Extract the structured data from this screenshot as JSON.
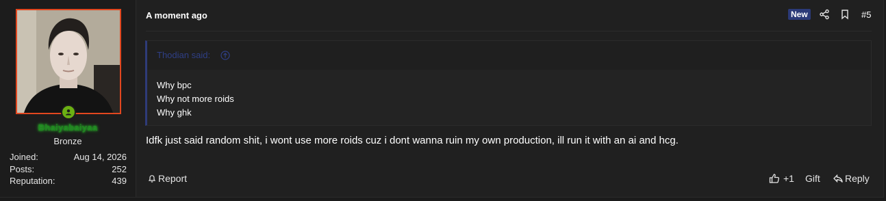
{
  "user": {
    "avatar_alt": "user avatar",
    "username": "Bhaiyabaiyaa",
    "rank": "Bronze",
    "stats": [
      {
        "label": "Joined:",
        "value": "Aug 14, 2026"
      },
      {
        "label": "Posts:",
        "value": "252"
      },
      {
        "label": "Reputation:",
        "value": "439"
      }
    ]
  },
  "header": {
    "timestamp": "A moment ago",
    "badge": "New",
    "post_number": "#5"
  },
  "quote": {
    "author": "Thodian said:",
    "lines": [
      "Why bpc",
      "Why not more roids",
      "Why ghk"
    ]
  },
  "message": "Idfk just said random shit, i wont use more roids cuz i dont wanna ruin my own production, ill run it with an ai and hcg.",
  "footer": {
    "report_label": "Report",
    "like_count": "+1",
    "gift_label": "Gift",
    "reply_label": "Reply"
  },
  "colors": {
    "accent_blue": "#2b3a78",
    "avatar_border": "#e2471f",
    "online_green": "#6bb013",
    "username_green": "#1f8a1f"
  }
}
